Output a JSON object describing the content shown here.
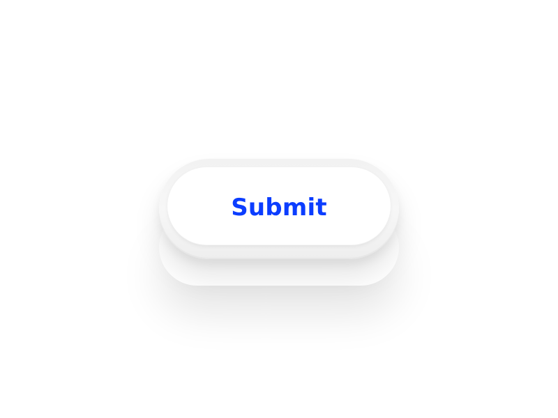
{
  "colors": {
    "background": "#ffffff",
    "button_surface": "#ffffff",
    "button_rim": "#f2f2f2",
    "label": "#0b3dff"
  },
  "button": {
    "label": "Submit"
  }
}
